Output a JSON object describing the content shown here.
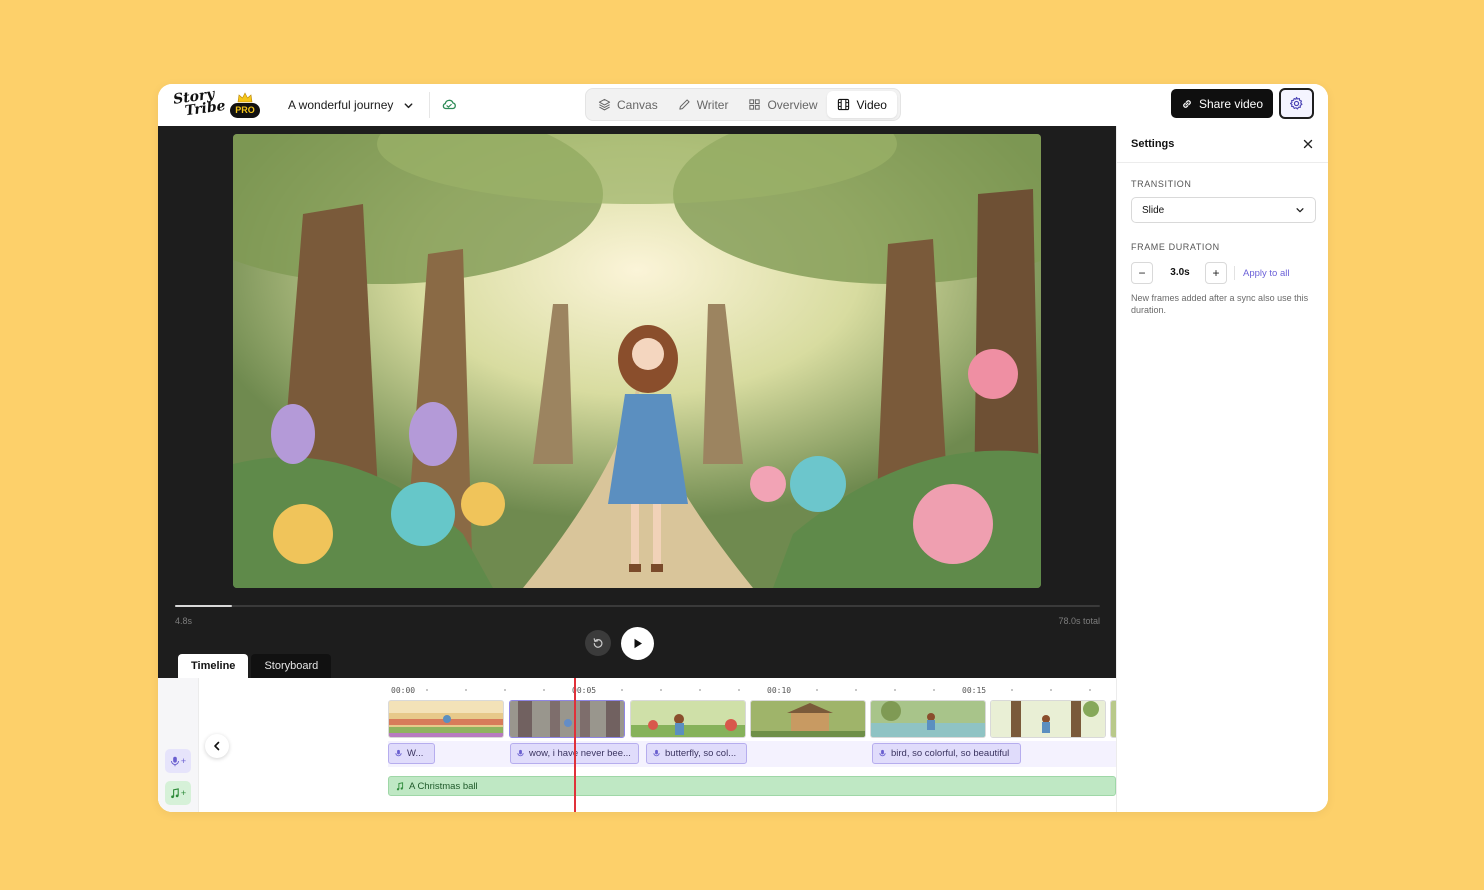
{
  "brand": {
    "logo_line1": "Story",
    "logo_line2": "Tribe",
    "badge": "PRO"
  },
  "project": {
    "name": "A wonderful journey"
  },
  "modes": [
    {
      "label": "Canvas",
      "icon": "layers-icon"
    },
    {
      "label": "Writer",
      "icon": "pencil-icon"
    },
    {
      "label": "Overview",
      "icon": "grid-icon"
    },
    {
      "label": "Video",
      "icon": "film-icon",
      "active": true
    }
  ],
  "header": {
    "share_label": "Share video"
  },
  "player": {
    "current_time": "4.8s",
    "total_time": "78.0s total",
    "progress": 0.062
  },
  "tabs": {
    "timeline": "Timeline",
    "storyboard": "Storyboard"
  },
  "timeline": {
    "ruler": [
      "00:00",
      "00:05",
      "00:10",
      "00:15"
    ],
    "voice_clips": [
      "W...",
      "wow, i have never bee...",
      "butterfly, so col...",
      "bird, so colorful, so beautiful"
    ],
    "music_clip": "A Christmas ball"
  },
  "settings": {
    "title": "Settings",
    "transition_label": "TRANSITION",
    "transition_value": "Slide",
    "duration_label": "FRAME DURATION",
    "duration_value": "3.0s",
    "apply_label": "Apply to all",
    "help": "New frames added after a sync also use this duration."
  },
  "colors": {
    "background": "#FDD06A",
    "accent": "#6c62d8",
    "playhead": "#e0313a",
    "music": "#bfe8c4",
    "voice": "#e0dcfb"
  }
}
